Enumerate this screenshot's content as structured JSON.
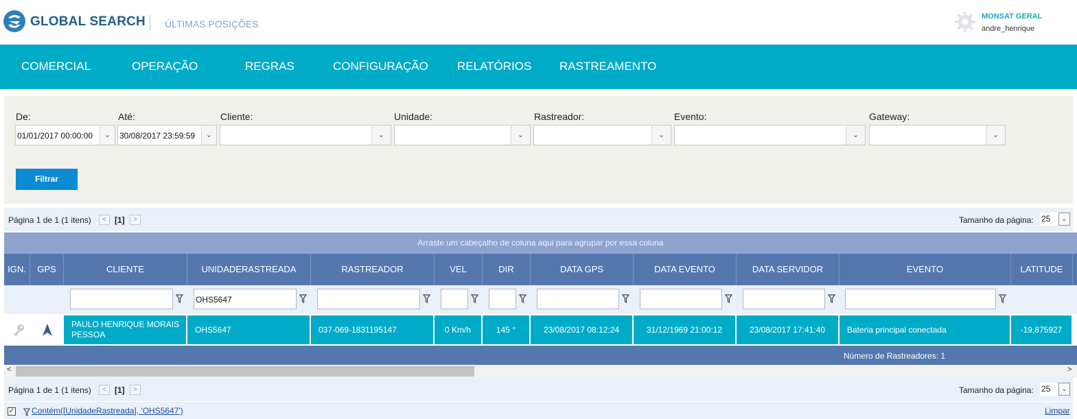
{
  "header": {
    "brand": "GLOBAL SEARCH",
    "page_title": "ÚLTIMAS POSIÇÕES",
    "company": "MONSAT GERAL",
    "username": "andre_henrique"
  },
  "nav": [
    "COMERCIAL",
    "OPERAÇÃO",
    "REGRAS",
    "CONFIGURAÇÃO",
    "RELATÓRIOS",
    "RASTREAMENTO"
  ],
  "filters": {
    "de": {
      "label": "De:",
      "value": "01/01/2017 00:00:00"
    },
    "ate": {
      "label": "Até:",
      "value": "30/08/2017 23:59:59"
    },
    "cliente": {
      "label": "Cliente:",
      "value": ""
    },
    "unidade": {
      "label": "Unidade:",
      "value": ""
    },
    "rastreador": {
      "label": "Rastreador:",
      "value": ""
    },
    "evento": {
      "label": "Evento:",
      "value": ""
    },
    "gateway": {
      "label": "Gateway:",
      "value": ""
    },
    "button": "Filtrar"
  },
  "pager": {
    "summary": "Página 1 de 1 (1 itens)",
    "current": "[1]",
    "size_label": "Tamanho da página:",
    "size": "25"
  },
  "grid": {
    "group_hint": "Arraste um cabeçalho de coluna aqui para agrupar por essa coluna",
    "columns": [
      "IGN.",
      "GPS",
      "CLIENTE",
      "UNIDADERASTREADA",
      "RASTREADOR",
      "VEL",
      "DIR",
      "DATA GPS",
      "DATA EVENTO",
      "DATA SERVIDOR",
      "EVENTO",
      "LATITUDE"
    ],
    "filter_values": {
      "unidade": "OHS5647"
    },
    "row": {
      "cliente": "PAULO HENRIQUE MORAIS PESSOA",
      "unidade": "OHS5647",
      "rastreador": "037-069-1831195147",
      "vel": "0 Km/h",
      "dir": "145 °",
      "data_gps": "23/08/2017 08:12:24",
      "data_evento": "31/12/1969 21:00:12",
      "data_servidor": "23/08/2017 17:41:40",
      "evento": "Bateria principal conectada",
      "latitude": "-19,875927"
    },
    "footer": "Número de Rastreadores: 1"
  },
  "filter_expression": {
    "text": "Contém([UnidadeRastreada], 'OHS5647')",
    "clear": "Limpar"
  },
  "colors": {
    "nav_bg": "#00abc8",
    "header_bg": "#5478ae",
    "selected_row": "#00abc8",
    "button": "#0b8bd1"
  }
}
